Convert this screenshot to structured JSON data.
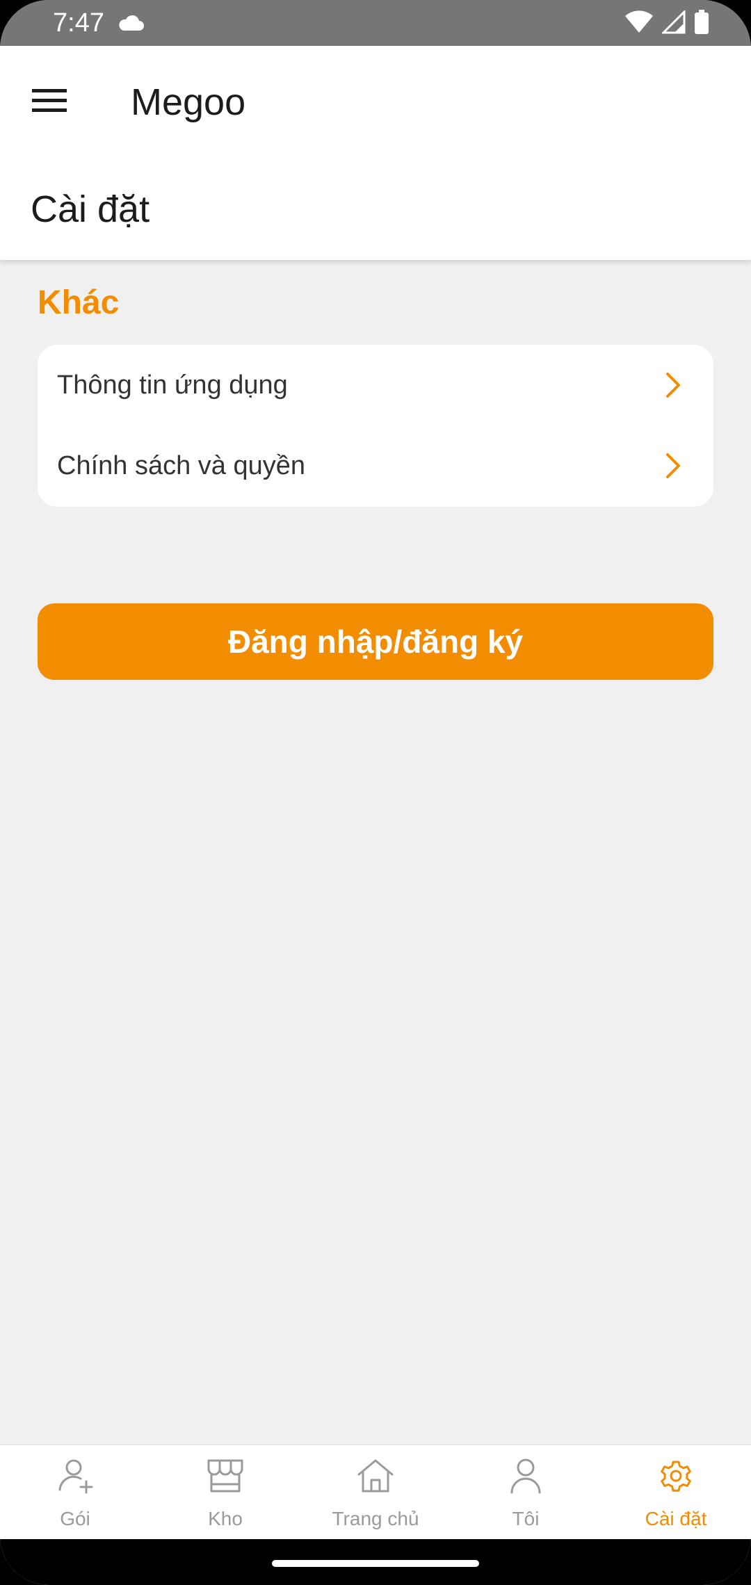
{
  "status_bar": {
    "time": "7:47"
  },
  "app_bar": {
    "title": "Megoo"
  },
  "page": {
    "title": "Cài đặt"
  },
  "section": {
    "title": "Khác"
  },
  "settings_items": [
    {
      "label": "Thông tin ứng dụng"
    },
    {
      "label": "Chính sách và quyền"
    }
  ],
  "login_button": {
    "label": "Đăng nhập/đăng ký"
  },
  "bottom_nav": {
    "items": [
      {
        "label": "Gói",
        "icon": "person-add-icon",
        "active": false
      },
      {
        "label": "Kho",
        "icon": "store-icon",
        "active": false
      },
      {
        "label": "Trang chủ",
        "icon": "home-icon",
        "active": false
      },
      {
        "label": "Tôi",
        "icon": "person-icon",
        "active": false
      },
      {
        "label": "Cài đặt",
        "icon": "gear-icon",
        "active": true
      }
    ]
  },
  "colors": {
    "accent": "#f28c00",
    "inactive": "#9a9a9a",
    "background": "#f0f0f0"
  }
}
